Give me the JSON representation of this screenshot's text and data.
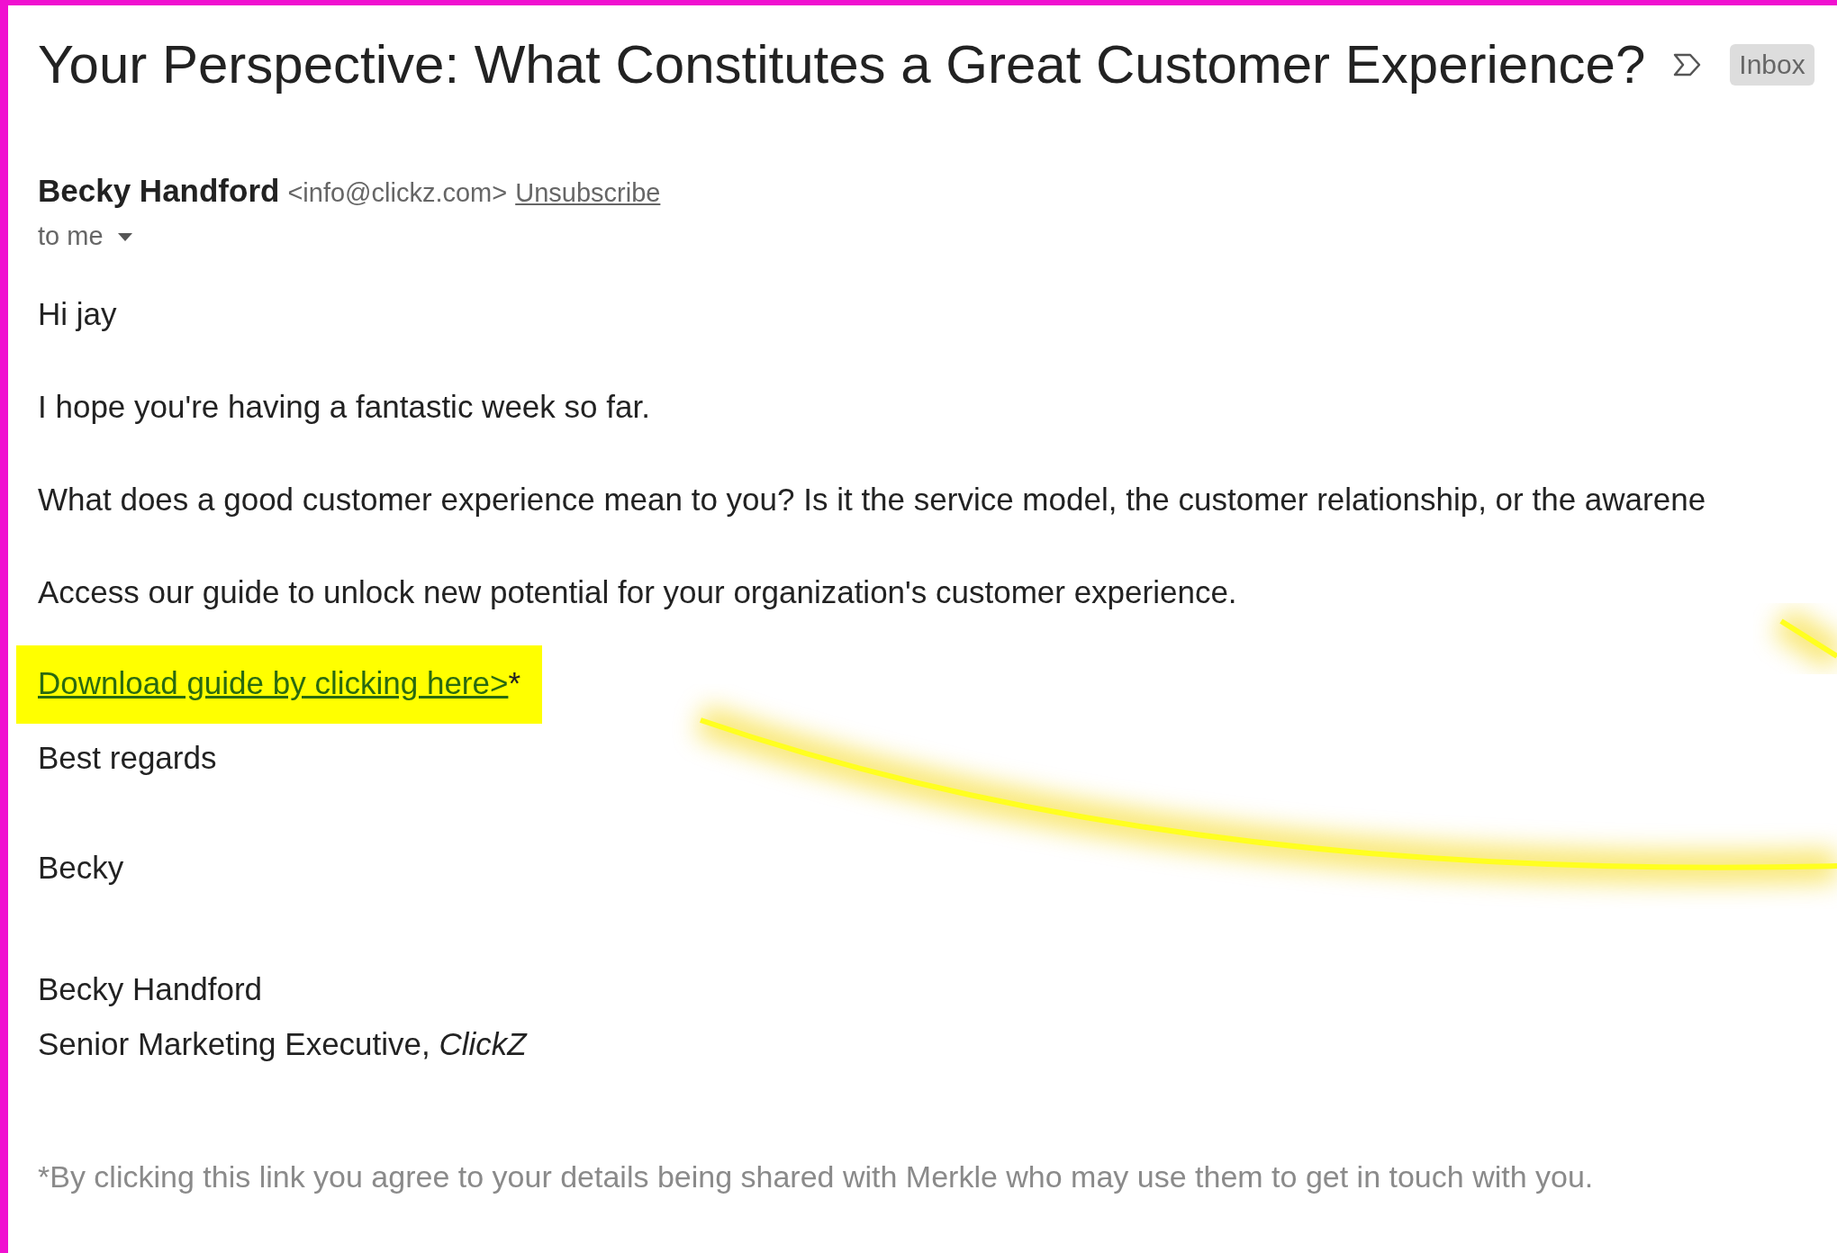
{
  "email": {
    "subject": "Your Perspective: What Constitutes a Great Customer Experience?",
    "label": "Inbox",
    "sender_name": "Becky Handford",
    "sender_address": "<info@clickz.com>",
    "unsubscribe": "Unsubscribe",
    "recipient": "to me"
  },
  "body": {
    "greeting": "Hi jay",
    "paragraphs": [
      "I hope you're having a fantastic week so far.",
      "What does a good customer experience mean to you? Is it the service model, the customer relationship, or the awarene",
      "Access our guide to unlock new potential for your organization's customer experience."
    ],
    "link": {
      "text": "Download guide by clicking here>",
      "suffix": "*",
      "highlighted": true
    },
    "closing": "Best regards",
    "signoff": "Becky",
    "signature_name": "Becky Handford",
    "signature_title": "Senior Marketing Executive, *ClickZ*"
  },
  "footer": "*By clicking this link you agree to your details being shared with Merkle who may use them to get in touch with you."
}
